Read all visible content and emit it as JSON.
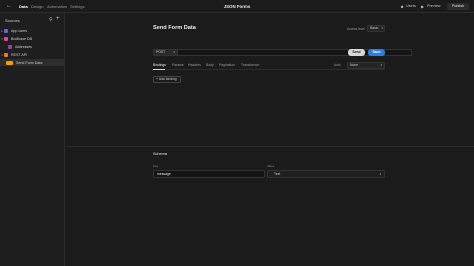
{
  "topbar": {
    "nav": [
      "Data",
      "Design",
      "Automation",
      "Settings"
    ],
    "active_tab": "Data",
    "app_title": "JSON Forms",
    "users_label": "Users",
    "preview_label": "Preview",
    "publish_label": "Publish"
  },
  "sidebar": {
    "title": "Sources",
    "items": [
      {
        "label": "App users",
        "icon": "app-users-icon",
        "color": "#6c5ce7"
      },
      {
        "label": "Budibase DB",
        "icon": "budibase-db-icon",
        "color": "#e84393"
      },
      {
        "label": "Addresses",
        "icon": "table-icon",
        "color": "#8e44ad"
      },
      {
        "label": "REST API",
        "icon": "rest-api-icon",
        "color": "#e67e22"
      },
      {
        "label": "Send Form Data",
        "icon": "post-query-badge",
        "color": "#f39c12",
        "selected": true
      }
    ]
  },
  "query": {
    "title": "Send Form Data",
    "access_label": "Access level",
    "access_value": "Basic",
    "verb": "POST",
    "url": "",
    "send_label": "Send",
    "save_label": "Save",
    "tabs": [
      "Bindings",
      "Params",
      "Headers",
      "Body",
      "Pagination",
      "Transformer"
    ],
    "active_tab": "Bindings",
    "auth_label": "Auth",
    "auth_value": "None",
    "add_binding_label": "Add binding"
  },
  "schema": {
    "title": "Schema",
    "key_header": "Key",
    "value_header": "Value",
    "rows": [
      {
        "key": "message",
        "value": "Text"
      }
    ]
  },
  "colors": {
    "accent": "#2f7de0",
    "background": "#1b1b1b"
  }
}
